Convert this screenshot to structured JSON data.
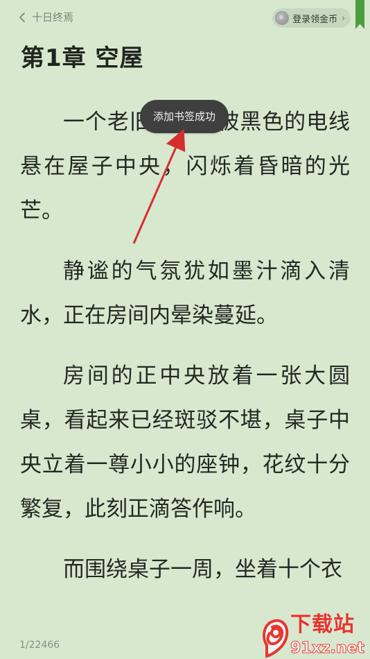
{
  "header": {
    "back_label": "十日终焉",
    "back_icon": "chevron-left-icon",
    "login_coin_label": "登录领金币",
    "coin_icon": "coin-icon",
    "chevron_icon": "chevron-right-icon",
    "bookmark_icon": "bookmark-ribbon-icon"
  },
  "chapter": {
    "title": "第1章 空屋"
  },
  "paragraphs": [
    "一个老旧的灯泡被黑色的电线悬在屋子中央，闪烁着昏暗的光芒。",
    "静谧的气氛犹如墨汁滴入清水，正在房间内晕染蔓延。",
    "房间的正中央放着一张大圆桌，看起来已经斑驳不堪，桌子中央立着一尊小小的座钟，花纹十分繁复，此刻正滴答作响。",
    "而围绕桌子一周，坐着十个衣"
  ],
  "toast": {
    "message": "添加书签成功"
  },
  "footer": {
    "page_indicator": "1/22466"
  },
  "watermark": {
    "top_text": "下载站",
    "bottom_text": "91xz.net"
  },
  "colors": {
    "background": "#d7e8cf",
    "text": "#232822",
    "toast_bg": "#3f3f3f",
    "bookmark": "#4c9d3d",
    "annotation_arrow": "#d62e2e",
    "watermark_red": "#e8332d"
  }
}
